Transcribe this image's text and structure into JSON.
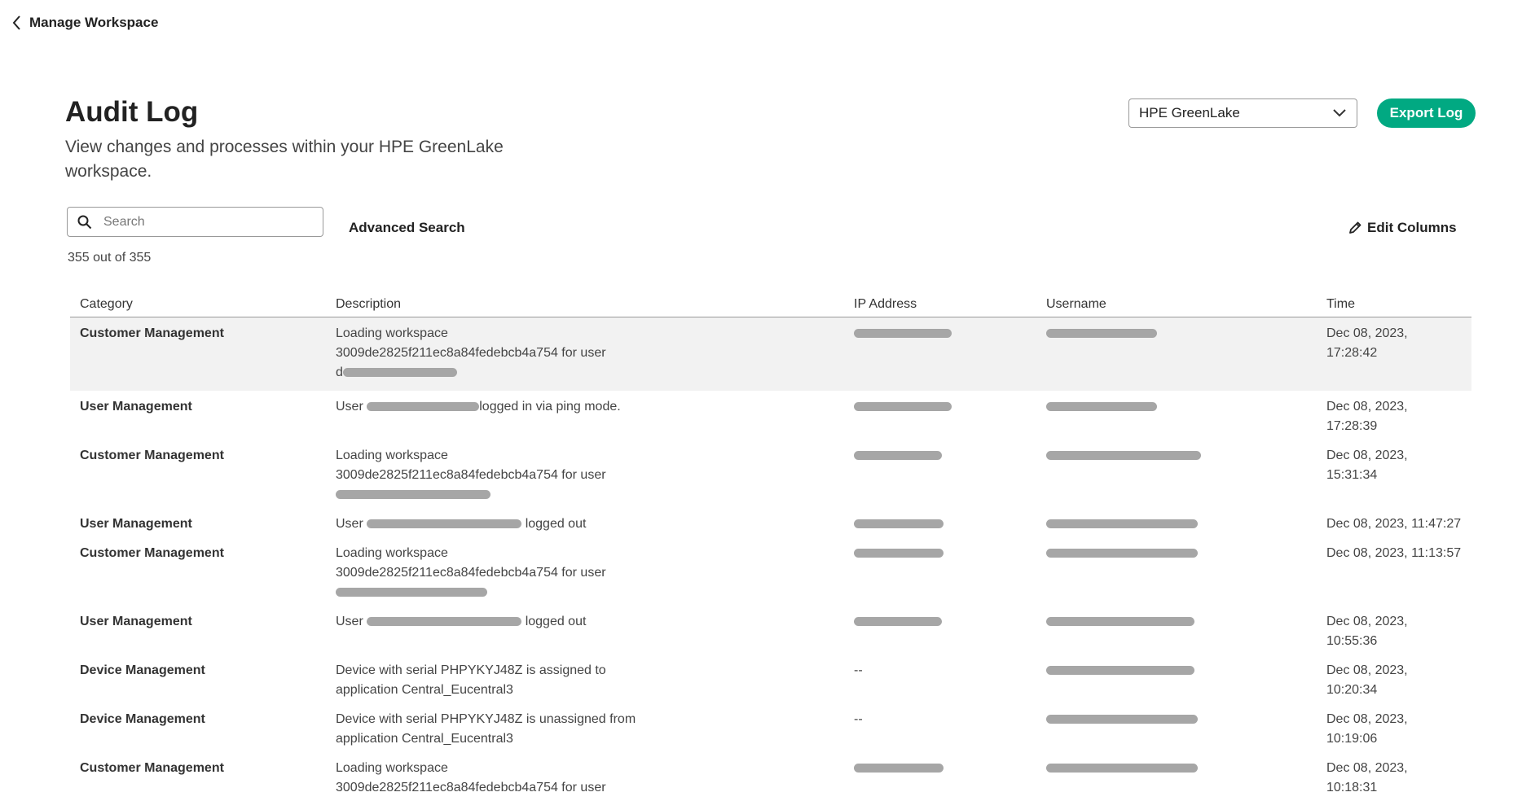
{
  "nav": {
    "back_label": "Manage Workspace"
  },
  "header": {
    "title": "Audit Log",
    "subtitle": "View changes and processes within your HPE GreenLake workspace.",
    "app_select_value": "HPE GreenLake",
    "export_label": "Export Log"
  },
  "toolbar": {
    "search_placeholder": "Search",
    "advanced_search_label": "Advanced Search",
    "edit_columns_label": "Edit Columns",
    "result_count": "355 out of 355"
  },
  "table": {
    "columns": [
      "Category",
      "Description",
      "IP Address",
      "Username",
      "Time"
    ],
    "rows": [
      {
        "category": "Customer Management",
        "desc_a": "Loading workspace",
        "desc_b": "3009de2825f211ec8a84fedebcb4a754 for user",
        "desc_c": "d",
        "ip": "",
        "user": "",
        "time": "Dec 08, 2023, 17:28:42"
      },
      {
        "category": "User Management",
        "desc_a": "User",
        "desc_b": "logged in via ping mode.",
        "ip": "",
        "user": "",
        "time": "Dec 08, 2023, 17:28:39"
      },
      {
        "category": "Customer Management",
        "desc_a": "Loading workspace",
        "desc_b": "3009de2825f211ec8a84fedebcb4a754 for user",
        "desc_c": "",
        "ip": "",
        "user": "",
        "time": "Dec 08, 2023, 15:31:34"
      },
      {
        "category": "User Management",
        "desc_a": "User",
        "desc_b": "logged out",
        "ip": "",
        "user": "",
        "time": "Dec 08, 2023, 11:47:27"
      },
      {
        "category": "Customer Management",
        "desc_a": "Loading workspace",
        "desc_b": "3009de2825f211ec8a84fedebcb4a754 for user",
        "desc_c": "",
        "ip": "",
        "user": "",
        "time": "Dec 08, 2023, 11:13:57"
      },
      {
        "category": "User Management",
        "desc_a": "User",
        "desc_b": "logged out",
        "ip": "",
        "user": "",
        "time": "Dec 08, 2023, 10:55:36"
      },
      {
        "category": "Device Management",
        "desc_a": "Device with serial PHPYKYJ48Z is assigned to",
        "desc_b": "application Central_Eucentral3",
        "ip": "--",
        "user": "",
        "time": "Dec 08, 2023, 10:20:34"
      },
      {
        "category": "Device Management",
        "desc_a": "Device with serial PHPYKYJ48Z is unassigned from",
        "desc_b": "application Central_Eucentral3",
        "ip": "--",
        "user": "",
        "time": "Dec 08, 2023, 10:19:06"
      },
      {
        "category": "Customer Management",
        "desc_a": "Loading workspace",
        "desc_b": "3009de2825f211ec8a84fedebcb4a754 for user",
        "ip": "",
        "user": "",
        "time": "Dec 08, 2023, 10:18:31"
      }
    ]
  },
  "colors": {
    "accent": "#01a982",
    "row_highlight": "#f2f2f2",
    "redaction": "#a6a6a6"
  }
}
